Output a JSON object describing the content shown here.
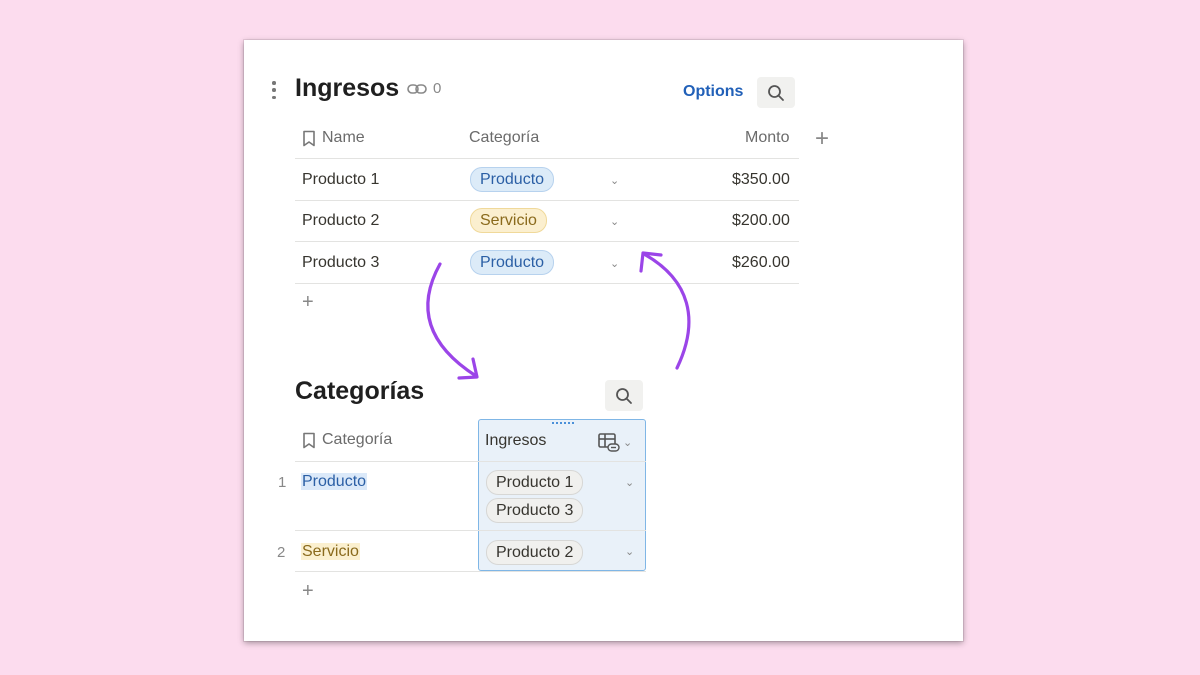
{
  "ingresos": {
    "title": "Ingresos",
    "link_count": "0",
    "options_label": "Options",
    "columns": {
      "name": "Name",
      "categoria": "Categoría",
      "monto": "Monto"
    },
    "rows": [
      {
        "name": "Producto 1",
        "categoria": "Producto",
        "monto": "$350.00"
      },
      {
        "name": "Producto 2",
        "categoria": "Servicio",
        "monto": "$200.00"
      },
      {
        "name": "Producto 3",
        "categoria": "Producto",
        "monto": "$260.00"
      }
    ],
    "add_row": "+",
    "add_column": "+"
  },
  "categorias": {
    "title": "Categorías",
    "columns": {
      "categoria": "Categoría",
      "ingresos": "Ingresos"
    },
    "rows": [
      {
        "num": "1",
        "categoria": "Producto",
        "ingresos": [
          "Producto 1",
          "Producto 3"
        ]
      },
      {
        "num": "2",
        "categoria": "Servicio",
        "ingresos": [
          "Producto 2"
        ]
      }
    ],
    "add_row": "+"
  },
  "colors": {
    "background": "#fcdcee",
    "accent": "#2160b8",
    "arrow": "#9b45e8",
    "tag_producto": "#dcebf8",
    "tag_servicio": "#fbefcf"
  }
}
